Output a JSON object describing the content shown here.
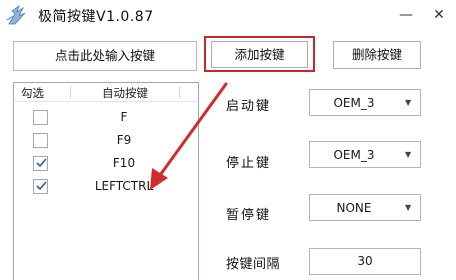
{
  "window": {
    "title": "极简按键V1.0.87",
    "minimize_glyph": "—",
    "close_glyph": "✕"
  },
  "toolbar": {
    "input_label": "点击此处输入按键",
    "add_label": "添加按键",
    "delete_label": "删除按键"
  },
  "key_list": {
    "columns": [
      "勾选",
      "自动按键"
    ],
    "rows": [
      {
        "key": "F",
        "checked": false
      },
      {
        "key": "F9",
        "checked": false
      },
      {
        "key": "F10",
        "checked": true
      },
      {
        "key": "LEFTCTRL",
        "checked": true
      }
    ]
  },
  "settings": {
    "start_key": {
      "label": "启动键",
      "value": "OEM_3"
    },
    "stop_key": {
      "label": "停止键",
      "value": "OEM_3"
    },
    "pause_key": {
      "label": "暂停键",
      "value": "NONE"
    },
    "interval": {
      "label": "按键间隔",
      "value": "30"
    }
  },
  "colors": {
    "highlight": "#c42828",
    "checkmark": "#2b5fa8"
  },
  "icons": [
    "app-logo-icon",
    "minimize-icon",
    "close-icon",
    "chevron-down-icon",
    "checkmark-icon"
  ]
}
